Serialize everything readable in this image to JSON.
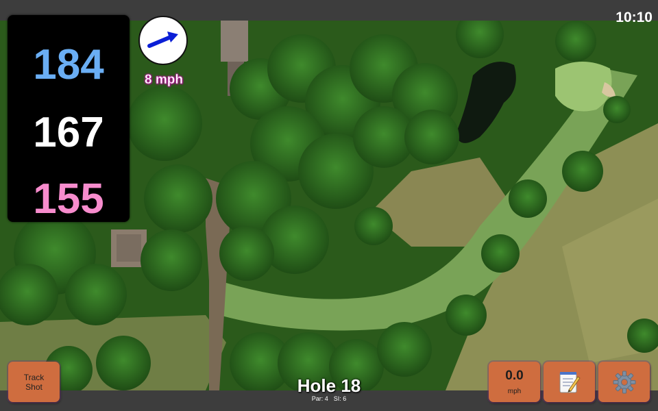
{
  "status": {
    "time": "10:10"
  },
  "distances": {
    "back": "184",
    "middle": "167",
    "front": "155"
  },
  "wind": {
    "speed_label": "8 mph",
    "direction_icon": "wind-arrow-icon"
  },
  "hole": {
    "title": "Hole 18",
    "par_label": "Par: 4",
    "si_label": "SI: 6"
  },
  "controls": {
    "track_shot_line1": "Track",
    "track_shot_line2": "Shot",
    "speed_value": "0.0",
    "speed_unit": "mph",
    "notes_icon": "notepad-icon",
    "settings_icon": "gear-icon"
  },
  "colors": {
    "back_distance": "#6aaef4",
    "middle_distance": "#ffffff",
    "front_distance": "#f78ccd",
    "button": "#cf6d3f",
    "wind_label": "#b71c9a"
  }
}
